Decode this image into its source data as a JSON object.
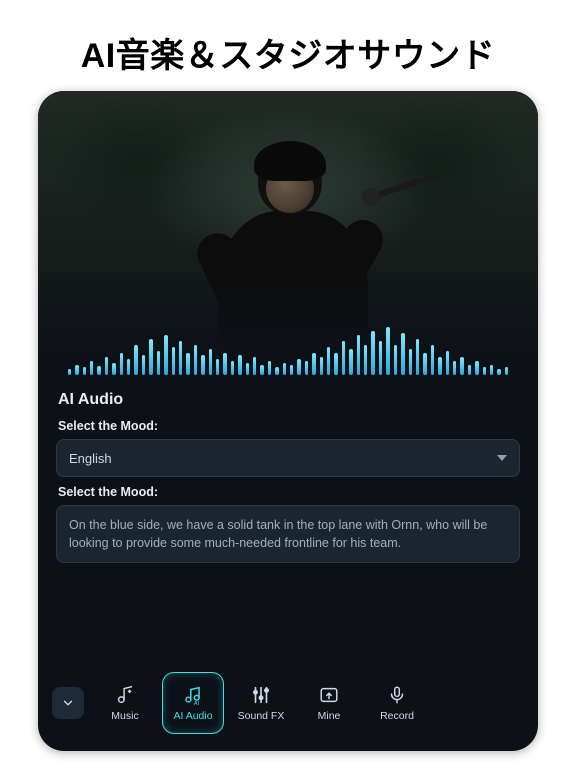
{
  "headline": "AI音楽＆スタジオサウンド",
  "panel": {
    "title": "AI Audio",
    "label1": "Select the Mood:",
    "select_value": "English",
    "label2": "Select the Mood:",
    "textarea_value": "On the blue side, we have a solid tank in the top lane with Ornn, who will be looking to provide some much-needed frontline for his team."
  },
  "tabs": [
    {
      "id": "music",
      "label": "Music"
    },
    {
      "id": "ai-audio",
      "label": "AI Audio"
    },
    {
      "id": "sound-fx",
      "label": "Sound FX"
    },
    {
      "id": "mine",
      "label": "Mine"
    },
    {
      "id": "record",
      "label": "Record"
    }
  ],
  "active_tab": "ai-audio",
  "waveform_heights": [
    6,
    10,
    8,
    14,
    9,
    18,
    12,
    22,
    16,
    30,
    20,
    36,
    24,
    40,
    28,
    34,
    22,
    30,
    20,
    26,
    16,
    22,
    14,
    20,
    12,
    18,
    10,
    14,
    8,
    12,
    10,
    16,
    14,
    22,
    18,
    28,
    22,
    34,
    26,
    40,
    30,
    44,
    34,
    48,
    30,
    42,
    26,
    36,
    22,
    30,
    18,
    24,
    14,
    18,
    10,
    14,
    8,
    10,
    6,
    8
  ]
}
